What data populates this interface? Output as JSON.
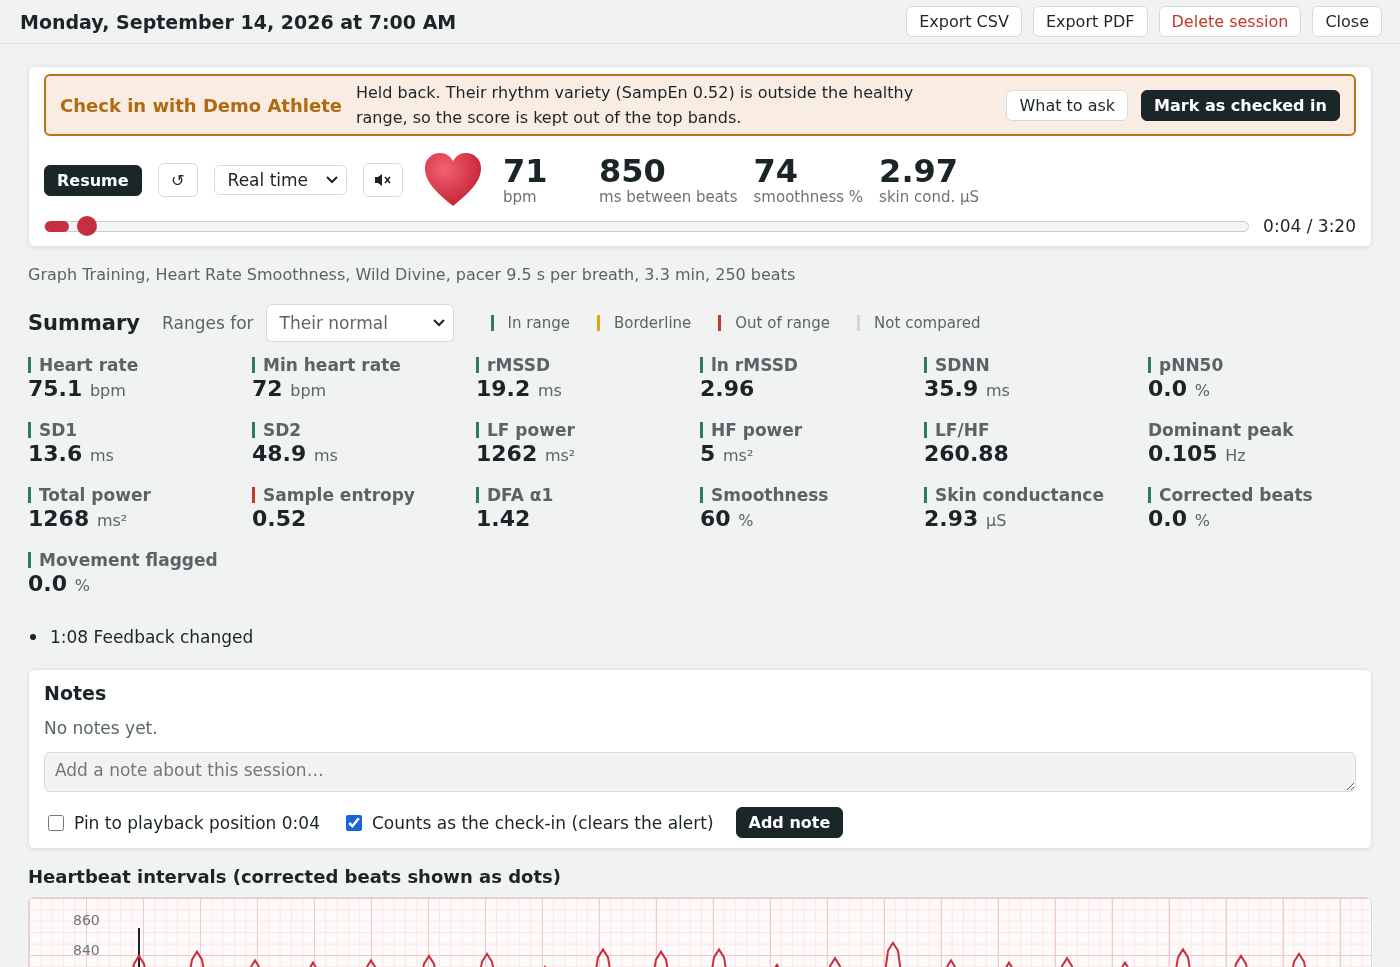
{
  "header": {
    "title": "Monday, September 14, 2026 at 7:00 AM",
    "buttons": [
      {
        "label": "Export CSV",
        "kind": "normal"
      },
      {
        "label": "Export PDF",
        "kind": "normal"
      },
      {
        "label": "Delete session",
        "kind": "danger"
      },
      {
        "label": "Close",
        "kind": "normal"
      }
    ]
  },
  "alert": {
    "title": "Check in with Demo Athlete",
    "message": "Held back. Their rhythm variety (SampEn 0.52) is outside the healthy range, so the score is kept out of the top bands.",
    "buttons": [
      {
        "label": "What to ask",
        "kind": "normal"
      },
      {
        "label": "Mark as checked in",
        "kind": "primary"
      }
    ]
  },
  "player": {
    "resume": "Resume",
    "restart": "↺",
    "speed": "Real time",
    "muted": true,
    "stats": [
      {
        "value": "71",
        "label": "bpm"
      },
      {
        "value": "850",
        "label": "ms between beats"
      },
      {
        "value": "74",
        "label": "smoothness %"
      },
      {
        "value": "2.97",
        "label": "skin cond. µS"
      }
    ],
    "position": {
      "level": 0.02
    },
    "time": "0:04 / 3:20"
  },
  "caption": "Graph Training, Heart Rate Smoothness, Wild Divine, pacer 9.5 s per breath, 3.3 min, 250 beats",
  "summary": {
    "title": "Summary",
    "ranges_label": "Ranges for",
    "ranges": "Their normal",
    "legend": [
      {
        "label": "In range",
        "color": "#2e7d5b"
      },
      {
        "label": "Borderline",
        "color": "#e0a514"
      },
      {
        "label": "Out of range",
        "color": "#c0392b"
      },
      {
        "label": "Not compared",
        "color": "#d3d7d9"
      }
    ],
    "metrics": [
      {
        "label": "Heart rate",
        "value": "75.1",
        "unit": "bpm",
        "color": "#2e7d5b"
      },
      {
        "label": "Min heart rate",
        "value": "72",
        "unit": "bpm",
        "color": "#2e7d5b"
      },
      {
        "label": "rMSSD",
        "value": "19.2",
        "unit": "ms",
        "color": "#2e7d5b"
      },
      {
        "label": "ln rMSSD",
        "value": "2.96",
        "color": "#2e7d5b"
      },
      {
        "label": "SDNN",
        "value": "35.9",
        "unit": "ms",
        "color": "#2e7d5b"
      },
      {
        "label": "pNN50",
        "value": "0.0",
        "unit": "%",
        "color": "#2e7d5b"
      },
      {
        "label": "SD1",
        "value": "13.6",
        "unit": "ms",
        "color": "#2e7d5b"
      },
      {
        "label": "SD2",
        "value": "48.9",
        "unit": "ms",
        "color": "#2e7d5b"
      },
      {
        "label": "LF power",
        "value": "1262",
        "unit": "ms²",
        "color": "#2e7d5b"
      },
      {
        "label": "HF power",
        "value": "5",
        "unit": "ms²",
        "color": "#2e7d5b"
      },
      {
        "label": "LF/HF",
        "value": "260.88",
        "color": "#2e7d5b"
      },
      {
        "label": "Dominant peak",
        "value": "0.105",
        "unit": "Hz"
      },
      {
        "label": "Total power",
        "value": "1268",
        "unit": "ms²",
        "color": "#2e7d5b"
      },
      {
        "label": "Sample entropy",
        "value": "0.52",
        "color": "#c0392b"
      },
      {
        "label": "DFA α1",
        "value": "1.42",
        "color": "#2e7d5b"
      },
      {
        "label": "Smoothness",
        "value": "60",
        "unit": "%",
        "color": "#2e7d5b"
      },
      {
        "label": "Skin conductance",
        "value": "2.93",
        "unit": "µS",
        "color": "#2e7d5b"
      },
      {
        "label": "Corrected beats",
        "value": "0.0",
        "unit": "%",
        "color": "#2e7d5b"
      },
      {
        "label": "Movement flagged",
        "value": "0.0",
        "unit": "%",
        "color": "#2e7d5b"
      }
    ]
  },
  "events": [
    "1:08 Feedback changed"
  ],
  "notes": {
    "title": "Notes",
    "empty": "No notes yet.",
    "placeholder": "Add a note about this session…",
    "options": [
      {
        "label": "Pin to playback position 0:04",
        "checked": false
      },
      {
        "label": "Counts as the check-in (clears the alert)",
        "checked": true
      }
    ],
    "add": "Add note"
  },
  "chart": {
    "title": "Heartbeat intervals (corrected beats shown as dots)",
    "ytick_labels": [
      "860",
      "840"
    ]
  }
}
